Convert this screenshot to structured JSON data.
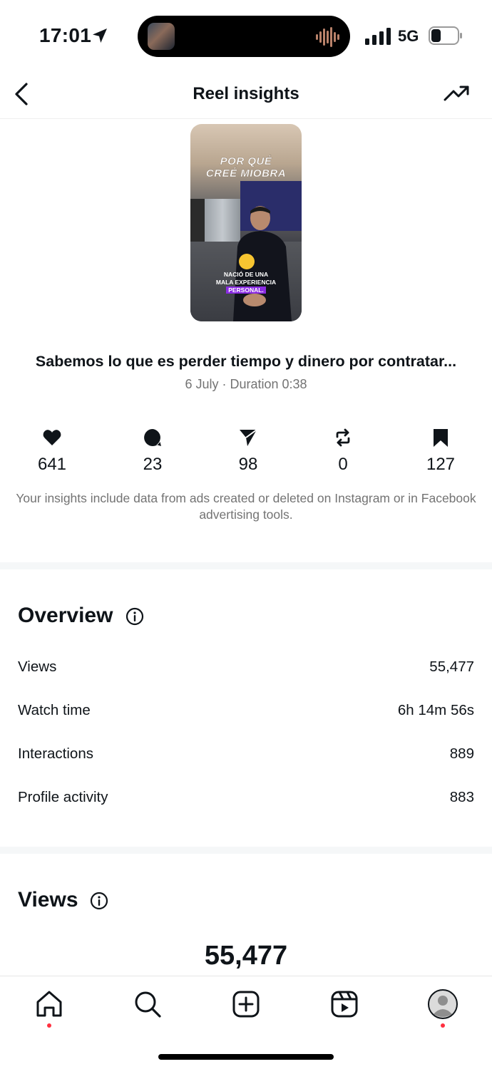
{
  "status": {
    "time": "17:01",
    "network": "5G"
  },
  "header": {
    "title": "Reel insights"
  },
  "thumbnail": {
    "title_line1": "POR QUÉ",
    "title_line2": "CREÉ MIOBRA",
    "caption_line1": "NACIÓ DE UNA",
    "caption_line2": "MALA EXPERIENCIA",
    "caption_highlight": "PERSONAL."
  },
  "reel": {
    "caption": "Sabemos lo que es perder tiempo y dinero por contratar...",
    "meta": "6 July · Duration 0:38"
  },
  "stats": {
    "likes": "641",
    "comments": "23",
    "shares": "98",
    "reposts": "0",
    "saves": "127"
  },
  "note": "Your insights include data from ads created or deleted on Instagram or in Facebook advertising tools.",
  "overview": {
    "title": "Overview",
    "rows": [
      {
        "label": "Views",
        "value": "55,477"
      },
      {
        "label": "Watch time",
        "value": "6h 14m 56s"
      },
      {
        "label": "Interactions",
        "value": "889"
      },
      {
        "label": "Profile activity",
        "value": "883"
      }
    ]
  },
  "views_section": {
    "title": "Views",
    "total": "55,477"
  },
  "colors": {
    "notification_dot": "#ff3040",
    "secondary_text": "#737373",
    "highlight": "#8a2be2"
  },
  "icons": [
    "location-arrow-icon",
    "signal-icon",
    "battery-icon",
    "back-icon",
    "trend-icon",
    "heart-icon",
    "comment-icon",
    "send-icon",
    "repost-icon",
    "bookmark-icon",
    "info-icon",
    "home-icon",
    "search-icon",
    "create-icon",
    "reels-icon",
    "profile-icon"
  ]
}
